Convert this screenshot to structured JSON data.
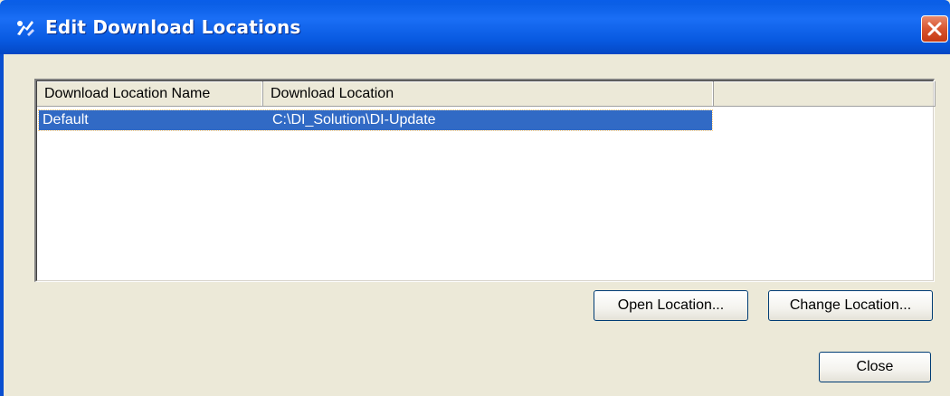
{
  "window": {
    "title": "Edit Download Locations"
  },
  "list": {
    "columns": [
      "Download Location Name",
      "Download Location",
      ""
    ],
    "rows": [
      {
        "name": "Default",
        "location": "C:\\DI_Solution\\DI-Update"
      }
    ]
  },
  "buttons": {
    "open_location": "Open Location...",
    "change_location": "Change Location...",
    "close": "Close"
  },
  "colors": {
    "titlebar": "#0a5ee8",
    "selection": "#316ac5",
    "dialog_bg": "#ece9d8",
    "close_button": "#d8542e"
  },
  "icons": {
    "title": "app-icon",
    "close": "close-icon"
  }
}
